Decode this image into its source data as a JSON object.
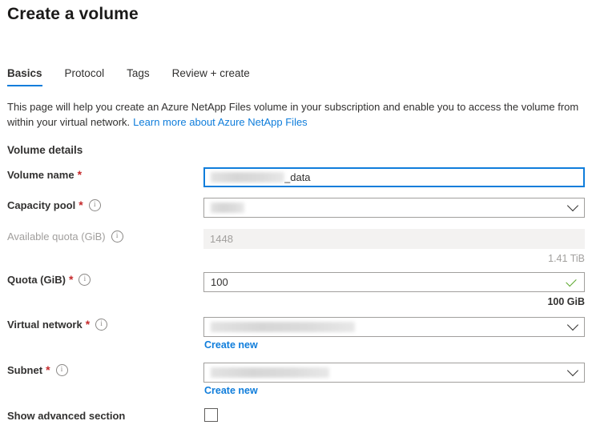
{
  "page": {
    "title": "Create a volume"
  },
  "tabs": [
    {
      "label": "Basics",
      "active": true
    },
    {
      "label": "Protocol",
      "active": false
    },
    {
      "label": "Tags",
      "active": false
    },
    {
      "label": "Review + create",
      "active": false
    }
  ],
  "intro": {
    "text": "This page will help you create an Azure NetApp Files volume in your subscription and enable you to access the volume from within your virtual network.",
    "link_text": "Learn more about Azure NetApp Files"
  },
  "section": {
    "heading": "Volume details"
  },
  "fields": {
    "volume_name": {
      "label": "Volume name",
      "required_marker": "*",
      "value_suffix": "_data",
      "redacted": true
    },
    "capacity_pool": {
      "label": "Capacity pool",
      "required_marker": "*",
      "value": "",
      "redacted": true,
      "chevron": "chevron-down-icon"
    },
    "available_quota": {
      "label": "Available quota (GiB)",
      "value": "1448",
      "hint": "1.41 TiB",
      "disabled": true
    },
    "quota": {
      "label": "Quota (GiB)",
      "required_marker": "*",
      "value": "100",
      "hint": "100 GiB",
      "validation": "valid-check-icon"
    },
    "virtual_network": {
      "label": "Virtual network",
      "required_marker": "*",
      "value": "",
      "redacted": true,
      "create_new_label": "Create new",
      "chevron": "chevron-down-icon"
    },
    "subnet": {
      "label": "Subnet",
      "required_marker": "*",
      "value": "",
      "redacted": true,
      "create_new_label": "Create new",
      "chevron": "chevron-down-icon"
    },
    "show_advanced": {
      "label": "Show advanced section",
      "checked": false
    }
  },
  "colors": {
    "accent_blue": "#0f7ddb",
    "required_red": "#c5292b",
    "valid_green": "#5ca82e",
    "text": "#323130",
    "disabled_text": "#a19f9d",
    "disabled_bg": "#f3f2f1",
    "border": "#a19f9d"
  }
}
